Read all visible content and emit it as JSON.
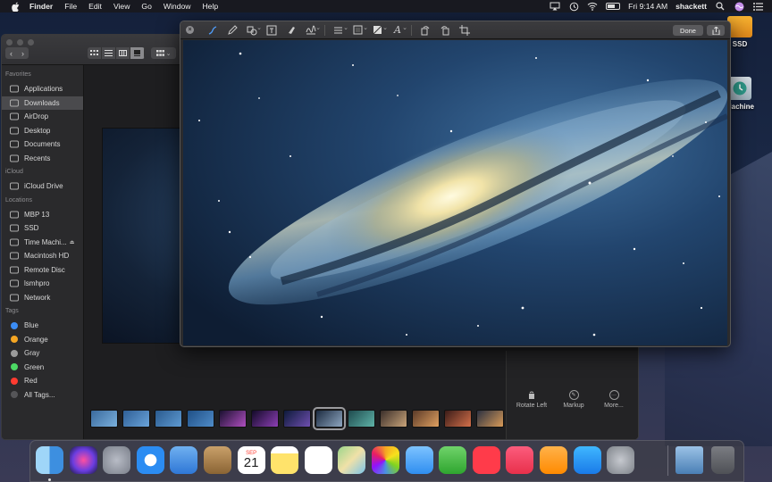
{
  "menubar": {
    "app_name": "Finder",
    "menus": [
      "File",
      "Edit",
      "View",
      "Go",
      "Window",
      "Help"
    ],
    "clock": "Fri 9:14 AM",
    "user": "shackett",
    "battery_icon": "battery-icon",
    "status_icons": [
      "airplay-icon",
      "time-machine-icon",
      "wifi-icon",
      "battery-icon",
      "search-icon",
      "siri-icon",
      "notification-center-icon"
    ]
  },
  "desktop": {
    "icons": [
      {
        "label": "SSD",
        "icon": "orange-drive-icon"
      },
      {
        "label": "Machine",
        "icon": "time-machine-drive-icon"
      }
    ]
  },
  "finder": {
    "sidebar": {
      "sections": [
        {
          "heading": "Favorites",
          "items": [
            {
              "label": "Applications",
              "icon": "applications-icon"
            },
            {
              "label": "Downloads",
              "icon": "downloads-icon",
              "selected": true
            },
            {
              "label": "AirDrop",
              "icon": "airdrop-icon"
            },
            {
              "label": "Desktop",
              "icon": "desktop-icon"
            },
            {
              "label": "Documents",
              "icon": "documents-icon"
            },
            {
              "label": "Recents",
              "icon": "recents-icon"
            }
          ]
        },
        {
          "heading": "iCloud",
          "items": [
            {
              "label": "iCloud Drive",
              "icon": "icloud-icon"
            }
          ]
        },
        {
          "heading": "Locations",
          "items": [
            {
              "label": "MBP 13",
              "icon": "laptop-icon"
            },
            {
              "label": "SSD",
              "icon": "drive-icon"
            },
            {
              "label": "Time Machi...",
              "icon": "drive-icon",
              "eject": true
            },
            {
              "label": "Macintosh HD",
              "icon": "drive-icon"
            },
            {
              "label": "Remote Disc",
              "icon": "disc-icon"
            },
            {
              "label": "lsmhpro",
              "icon": "monitor-icon"
            },
            {
              "label": "Network",
              "icon": "network-icon"
            }
          ]
        },
        {
          "heading": "Tags",
          "items": [
            {
              "label": "Blue",
              "color": "#3b8df5"
            },
            {
              "label": "Orange",
              "color": "#f5a623"
            },
            {
              "label": "Gray",
              "color": "#9b9b9b"
            },
            {
              "label": "Green",
              "color": "#4cd964"
            },
            {
              "label": "Red",
              "color": "#ff3b30"
            },
            {
              "label": "All Tags...",
              "color": "#555558"
            }
          ]
        }
      ]
    },
    "info_actions": [
      {
        "label": "Rotate Left",
        "icon": "rotate-left-icon"
      },
      {
        "label": "Markup",
        "icon": "markup-icon"
      },
      {
        "label": "More...",
        "icon": "more-icon"
      }
    ],
    "thumbnails": [
      {
        "name": "thumb-1",
        "colors": [
          "#3a6a9e",
          "#7ab0dc"
        ]
      },
      {
        "name": "thumb-2",
        "colors": [
          "#2f5f96",
          "#6aa4da"
        ]
      },
      {
        "name": "thumb-3",
        "colors": [
          "#2a5a8e",
          "#5e9ad2"
        ]
      },
      {
        "name": "thumb-4",
        "colors": [
          "#1f4f86",
          "#4f8cc8"
        ]
      },
      {
        "name": "thumb-5",
        "colors": [
          "#1a1030",
          "#b04fc0"
        ]
      },
      {
        "name": "thumb-6",
        "colors": [
          "#120a28",
          "#8d3fb5"
        ]
      },
      {
        "name": "thumb-7",
        "colors": [
          "#0d1a3a",
          "#6f4fb0"
        ]
      },
      {
        "name": "thumb-8",
        "colors": [
          "#1c2b40",
          "#8ea6c0"
        ],
        "selected": true
      },
      {
        "name": "thumb-9",
        "colors": [
          "#1e4a4e",
          "#5fb3a8"
        ]
      },
      {
        "name": "thumb-10",
        "colors": [
          "#3a2e2a",
          "#c9a47a"
        ]
      },
      {
        "name": "thumb-11",
        "colors": [
          "#5a3a28",
          "#e0a060"
        ]
      },
      {
        "name": "thumb-12",
        "colors": [
          "#3a1c18",
          "#d4704a"
        ]
      },
      {
        "name": "thumb-13",
        "colors": [
          "#2a3040",
          "#d89a58"
        ]
      }
    ]
  },
  "markup": {
    "done_label": "Done",
    "tools": [
      "sketch-icon",
      "draw-icon",
      "shapes-icon",
      "text-box-icon",
      "highlight-icon",
      "sign-icon",
      "shape-style-icon",
      "border-color-icon",
      "fill-color-icon",
      "text-style-icon",
      "rotate-left-icon",
      "rotate-right-icon",
      "crop-icon"
    ]
  },
  "dock": {
    "apps": [
      {
        "name": "finder",
        "icon": "finder-icon",
        "running": true
      },
      {
        "name": "siri",
        "icon": "siri-icon"
      },
      {
        "name": "launchpad",
        "icon": "launchpad-icon"
      },
      {
        "name": "safari",
        "icon": "safari-icon"
      },
      {
        "name": "mail",
        "icon": "mail-icon"
      },
      {
        "name": "contacts",
        "icon": "contacts-icon"
      },
      {
        "name": "calendar",
        "icon": "calendar-icon",
        "month": "SEP",
        "day": "21"
      },
      {
        "name": "notes",
        "icon": "notes-icon"
      },
      {
        "name": "reminders",
        "icon": "reminders-icon"
      },
      {
        "name": "maps",
        "icon": "maps-icon"
      },
      {
        "name": "photos",
        "icon": "photos-icon"
      },
      {
        "name": "messages",
        "icon": "messages-icon"
      },
      {
        "name": "facetime",
        "icon": "facetime-icon"
      },
      {
        "name": "news",
        "icon": "news-icon"
      },
      {
        "name": "music",
        "icon": "music-icon"
      },
      {
        "name": "books",
        "icon": "books-icon"
      },
      {
        "name": "app-store",
        "icon": "app-store-icon"
      },
      {
        "name": "system-preferences",
        "icon": "system-preferences-icon"
      }
    ],
    "stack": {
      "name": "downloads-stack",
      "icon": "downloads-stack-icon"
    },
    "trash": {
      "name": "trash",
      "icon": "trash-icon"
    }
  }
}
